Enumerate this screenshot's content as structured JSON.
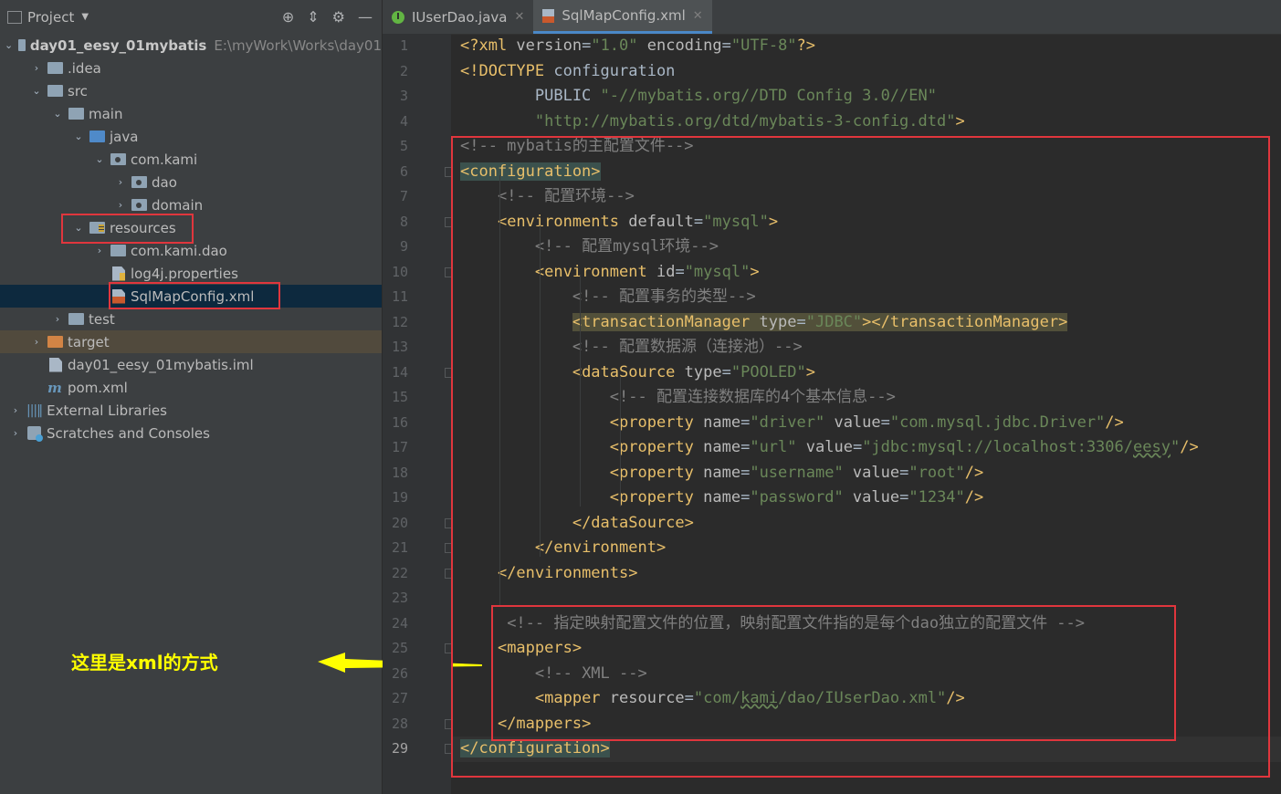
{
  "project_panel": {
    "title": "Project",
    "tree": [
      {
        "label": "day01_eesy_01mybatis",
        "hint": "E:\\myWork\\Works\\day01",
        "indent": 0,
        "arrow": "⌄",
        "icon": "module-folder-icon",
        "bold": true
      },
      {
        "label": ".idea",
        "indent": 1,
        "arrow": "›",
        "icon": "folder-icon"
      },
      {
        "label": "src",
        "indent": 1,
        "arrow": "⌄",
        "icon": "folder-icon"
      },
      {
        "label": "main",
        "indent": 2,
        "arrow": "⌄",
        "icon": "folder-icon"
      },
      {
        "label": "java",
        "indent": 3,
        "arrow": "⌄",
        "icon": "source-folder-icon"
      },
      {
        "label": "com.kami",
        "indent": 4,
        "arrow": "⌄",
        "icon": "package-icon"
      },
      {
        "label": "dao",
        "indent": 5,
        "arrow": "›",
        "icon": "package-icon"
      },
      {
        "label": "domain",
        "indent": 5,
        "arrow": "›",
        "icon": "package-icon"
      },
      {
        "label": "resources",
        "indent": 3,
        "arrow": "⌄",
        "icon": "resources-folder-icon"
      },
      {
        "label": "com.kami.dao",
        "indent": 4,
        "arrow": "›",
        "icon": "folder-icon"
      },
      {
        "label": "log4j.properties",
        "indent": 4,
        "arrow": "",
        "icon": "properties-file-icon"
      },
      {
        "label": "SqlMapConfig.xml",
        "indent": 4,
        "arrow": "",
        "icon": "xml-file-icon",
        "selected": true
      },
      {
        "label": "test",
        "indent": 2,
        "arrow": "›",
        "icon": "folder-icon"
      },
      {
        "label": "target",
        "indent": 1,
        "arrow": "›",
        "icon": "target-folder-icon",
        "highlight": true
      },
      {
        "label": "day01_eesy_01mybatis.iml",
        "indent": 1,
        "arrow": "",
        "icon": "iml-file-icon"
      },
      {
        "label": "pom.xml",
        "indent": 1,
        "arrow": "",
        "icon": "maven-icon"
      },
      {
        "label": "External Libraries",
        "indent": 0,
        "arrow": "›",
        "icon": "libraries-icon"
      },
      {
        "label": "Scratches and Consoles",
        "indent": 0,
        "arrow": "›",
        "icon": "scratches-icon"
      }
    ]
  },
  "annotation": {
    "text": "这里是xml的方式",
    "color": "#ffff00"
  },
  "tabs": [
    {
      "label": "IUserDao.java",
      "icon": "java-interface-icon",
      "active": false
    },
    {
      "label": "SqlMapConfig.xml",
      "icon": "xml-file-icon",
      "active": true
    }
  ],
  "editor": {
    "current_line": 29,
    "lines": [
      [
        [
          "pi",
          "<?xml "
        ],
        [
          "attr",
          "version"
        ],
        [
          "txt",
          "="
        ],
        [
          "val",
          "\"1.0\""
        ],
        [
          "attr",
          " encoding"
        ],
        [
          "txt",
          "="
        ],
        [
          "val",
          "\"UTF-8\""
        ],
        [
          "pi",
          "?>"
        ]
      ],
      [
        [
          "tag",
          "<!DOCTYPE "
        ],
        [
          "txt",
          "configuration"
        ]
      ],
      [
        [
          "txt",
          "        PUBLIC "
        ],
        [
          "val",
          "\"-//mybatis.org//DTD Config 3.0//EN\""
        ]
      ],
      [
        [
          "txt",
          "        "
        ],
        [
          "val",
          "\"http://mybatis.org/dtd/mybatis-3-config.dtd\""
        ],
        [
          "tag",
          ">"
        ]
      ],
      [
        [
          "com",
          "<!-- mybatis的主配置文件-->"
        ]
      ],
      [
        [
          "tag_hl",
          "<configuration>"
        ]
      ],
      [
        [
          "txt",
          "    "
        ],
        [
          "com",
          "<!-- 配置环境-->"
        ]
      ],
      [
        [
          "txt",
          "    "
        ],
        [
          "tag",
          "<environments "
        ],
        [
          "attr",
          "default"
        ],
        [
          "txt",
          "="
        ],
        [
          "val",
          "\"mysql\""
        ],
        [
          "tag",
          ">"
        ]
      ],
      [
        [
          "txt",
          "        "
        ],
        [
          "com",
          "<!-- 配置mysql环境-->"
        ]
      ],
      [
        [
          "txt",
          "        "
        ],
        [
          "tag",
          "<environment "
        ],
        [
          "attr",
          "id"
        ],
        [
          "txt",
          "="
        ],
        [
          "val",
          "\"mysql\""
        ],
        [
          "tag",
          ">"
        ]
      ],
      [
        [
          "txt",
          "            "
        ],
        [
          "com",
          "<!-- 配置事务的类型-->"
        ]
      ],
      [
        [
          "txt",
          "            "
        ],
        [
          "tagline_hl",
          "<transactionManager "
        ],
        [
          "attrline_hl",
          "type"
        ],
        [
          "txtline_hl",
          "="
        ],
        [
          "valline_hl",
          "\"JDBC\""
        ],
        [
          "tagline_hl",
          "></transactionManager>"
        ]
      ],
      [
        [
          "txt",
          "            "
        ],
        [
          "com",
          "<!-- 配置数据源（连接池）-->"
        ]
      ],
      [
        [
          "txt",
          "            "
        ],
        [
          "tag",
          "<dataSource "
        ],
        [
          "attr",
          "type"
        ],
        [
          "txt",
          "="
        ],
        [
          "val",
          "\"POOLED\""
        ],
        [
          "tag",
          ">"
        ]
      ],
      [
        [
          "txt",
          "                "
        ],
        [
          "com",
          "<!-- 配置连接数据库的4个基本信息-->"
        ]
      ],
      [
        [
          "txt",
          "                "
        ],
        [
          "tag",
          "<property "
        ],
        [
          "attr",
          "name"
        ],
        [
          "txt",
          "="
        ],
        [
          "val",
          "\"driver\""
        ],
        [
          "attr",
          " value"
        ],
        [
          "txt",
          "="
        ],
        [
          "val",
          "\"com.mysql.jdbc.Driver\""
        ],
        [
          "tag",
          "/>"
        ]
      ],
      [
        [
          "txt",
          "                "
        ],
        [
          "tag",
          "<property "
        ],
        [
          "attr",
          "name"
        ],
        [
          "txt",
          "="
        ],
        [
          "val",
          "\"url\""
        ],
        [
          "attr",
          " value"
        ],
        [
          "txt",
          "="
        ],
        [
          "val",
          "\"jdbc:mysql://localhost:3306/"
        ],
        [
          "valsq",
          "eesy"
        ],
        [
          "val",
          "\""
        ],
        [
          "tag",
          "/>"
        ]
      ],
      [
        [
          "txt",
          "                "
        ],
        [
          "tag",
          "<property "
        ],
        [
          "attr",
          "name"
        ],
        [
          "txt",
          "="
        ],
        [
          "val",
          "\"username\""
        ],
        [
          "attr",
          " value"
        ],
        [
          "txt",
          "="
        ],
        [
          "val",
          "\"root\""
        ],
        [
          "tag",
          "/>"
        ]
      ],
      [
        [
          "txt",
          "                "
        ],
        [
          "tag",
          "<property "
        ],
        [
          "attr",
          "name"
        ],
        [
          "txt",
          "="
        ],
        [
          "val",
          "\"password\""
        ],
        [
          "attr",
          " value"
        ],
        [
          "txt",
          "="
        ],
        [
          "val",
          "\"1234\""
        ],
        [
          "tag",
          "/>"
        ]
      ],
      [
        [
          "txt",
          "            "
        ],
        [
          "tag",
          "</dataSource>"
        ]
      ],
      [
        [
          "txt",
          "        "
        ],
        [
          "tag",
          "</environment>"
        ]
      ],
      [
        [
          "txt",
          "    "
        ],
        [
          "tag",
          "</environments>"
        ]
      ],
      [],
      [
        [
          "txt",
          "     "
        ],
        [
          "com",
          "<!-- 指定映射配置文件的位置，映射配置文件指的是每个dao独立的配置文件 -->"
        ]
      ],
      [
        [
          "txt",
          "    "
        ],
        [
          "tag",
          "<mappers>"
        ]
      ],
      [
        [
          "txt",
          "        "
        ],
        [
          "com",
          "<!-- XML -->"
        ]
      ],
      [
        [
          "txt",
          "        "
        ],
        [
          "tag",
          "<mapper "
        ],
        [
          "attr",
          "resource"
        ],
        [
          "txt",
          "="
        ],
        [
          "val",
          "\"com/"
        ],
        [
          "valsq",
          "kami"
        ],
        [
          "val",
          "/dao/IUserDao.xml\""
        ],
        [
          "tag",
          "/>"
        ]
      ],
      [
        [
          "txt",
          "    "
        ],
        [
          "tag",
          "</mappers>"
        ]
      ],
      [
        [
          "tag_hl",
          "</configuration>"
        ]
      ]
    ]
  }
}
